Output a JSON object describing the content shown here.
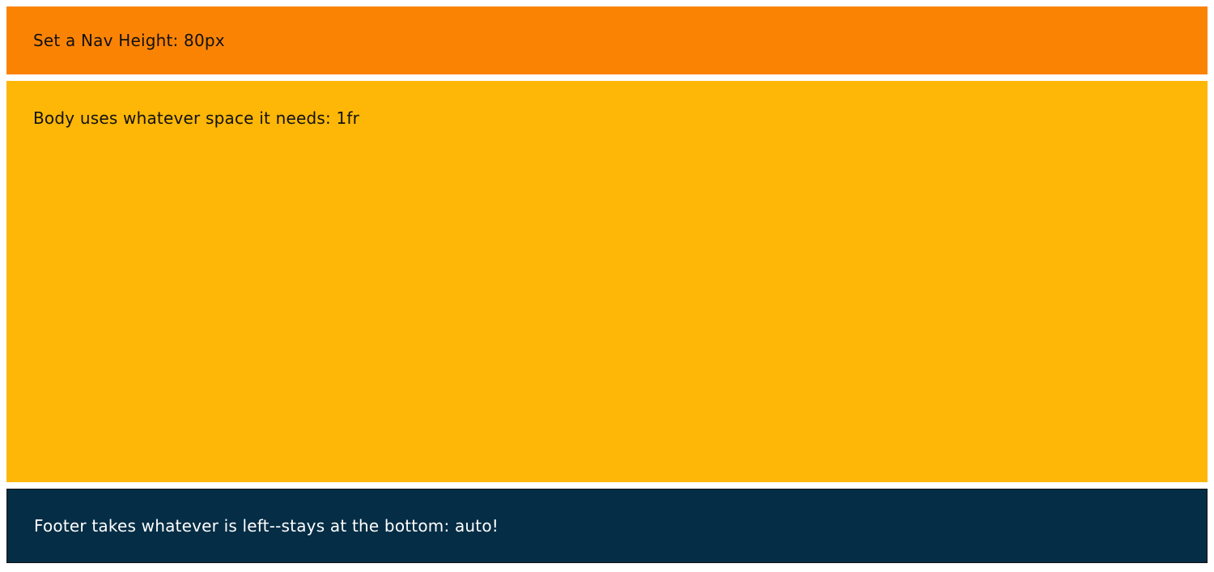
{
  "nav": {
    "text": "Set a Nav Height: 80px",
    "color": "#fb8304"
  },
  "content": {
    "text": "Body uses whatever space it needs: 1fr",
    "color": "#feb706"
  },
  "footer": {
    "text": "Footer takes whatever is left--stays at the bottom: auto!",
    "color": "#052d45"
  }
}
